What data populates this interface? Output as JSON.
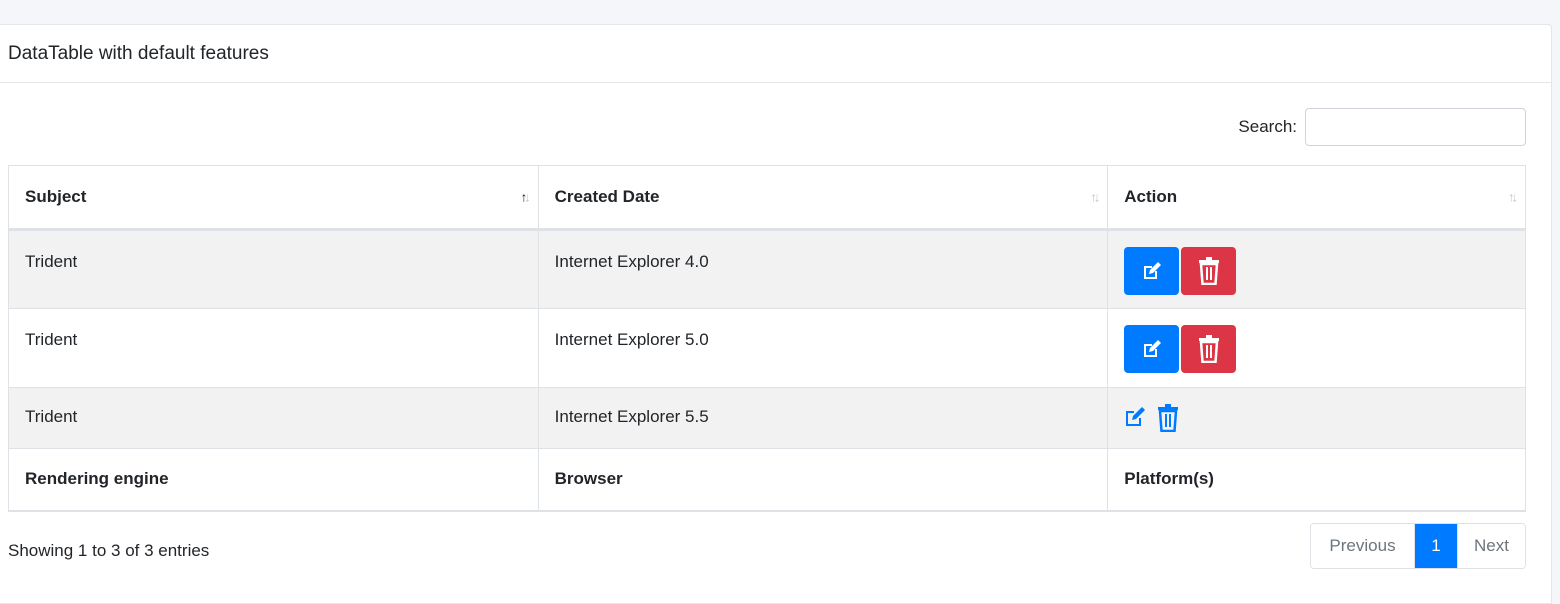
{
  "card": {
    "title": "DataTable with default features"
  },
  "search": {
    "label": "Search:",
    "value": "",
    "placeholder": ""
  },
  "table": {
    "headers": [
      "Subject",
      "Created Date",
      "Action"
    ],
    "rows": [
      {
        "subject": "Trident",
        "created_date": "Internet Explorer 4.0"
      },
      {
        "subject": "Trident",
        "created_date": "Internet Explorer 5.0"
      },
      {
        "subject": "Trident",
        "created_date": "Internet Explorer 5.5"
      }
    ],
    "footers": [
      "Rendering engine",
      "Browser",
      "Platform(s)"
    ]
  },
  "info": "Showing 1 to 3 of 3 entries",
  "pagination": {
    "previous": "Previous",
    "current": "1",
    "next": "Next"
  },
  "colors": {
    "primary": "#007bff",
    "danger": "#dc3545",
    "stripe": "#f2f2f2"
  },
  "icons": {
    "edit": "edit-icon",
    "delete": "trash-icon",
    "sort": "sort-icon"
  }
}
